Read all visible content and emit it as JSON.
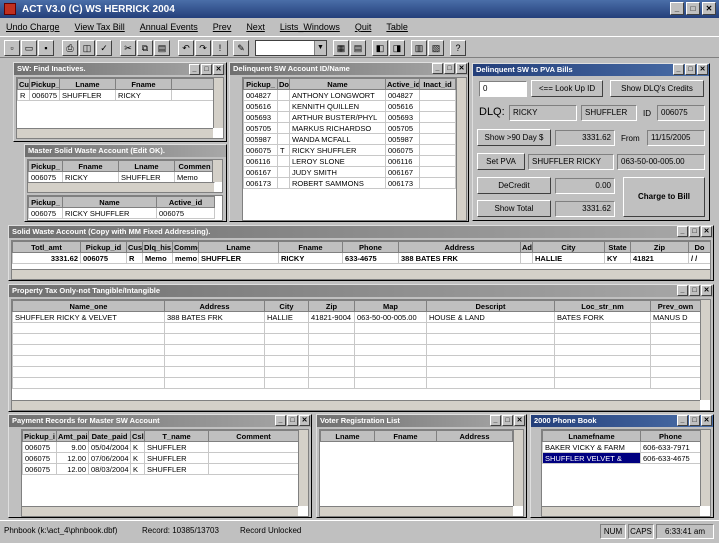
{
  "app": {
    "title": "ACT V3.0 (C) WS HERRICK 2004"
  },
  "menu": [
    "Undo Charge",
    "View Tax Bill",
    "Annual Events",
    "Prev",
    "Next",
    "Lists_Windows",
    "Quit",
    "Table"
  ],
  "sw_find": {
    "title": "SW: Find Inactives.",
    "headers": [
      "Cu",
      "Pickup_",
      "Lname",
      "Fname"
    ],
    "rows": [
      [
        "R",
        "006075",
        "SHUFFLER",
        "RICKY"
      ]
    ]
  },
  "master_sw": {
    "title": "Master Solid Waste Account (Edit OK).",
    "headers": [
      "Pickup_",
      "Fname",
      "Lname",
      "Commen"
    ],
    "rows": [
      [
        "006075",
        "RICKY",
        "SHUFFLER",
        "Memo"
      ]
    ],
    "headers2": [
      "Pickup_",
      "Name",
      "Active_id"
    ],
    "rows2": [
      [
        "006075",
        "RICKY SHUFFLER",
        "006075"
      ]
    ]
  },
  "delinquent_id": {
    "title": "Delinquent SW Account ID/Name",
    "headers": [
      "Pickup_",
      "Do",
      "Name",
      "Active_id",
      "Inact_id"
    ],
    "rows": [
      [
        "004827",
        "",
        "ANTHONY LONGWORT",
        "004827",
        ""
      ],
      [
        "005616",
        "",
        "KENNITH QUILLEN",
        "005616",
        ""
      ],
      [
        "005693",
        "",
        "ARTHUR BUSTER/PHYL",
        "005693",
        ""
      ],
      [
        "005705",
        "",
        "MARKUS RICHARDSO",
        "005705",
        ""
      ],
      [
        "005987",
        "",
        "WANDA MCFALL",
        "005987",
        ""
      ],
      [
        "006075",
        "T",
        "RICKY SHUFFLER",
        "006075",
        ""
      ],
      [
        "006116",
        "",
        "LEROY SLONE",
        "006116",
        ""
      ],
      [
        "006167",
        "",
        "JUDY SMITH",
        "006167",
        ""
      ],
      [
        "006173",
        "",
        "ROBERT SAMMONS",
        "006173",
        ""
      ]
    ]
  },
  "pva": {
    "title": "Delinquent SW to PVA Bills",
    "lookup_value": "0",
    "lookup_btn": "<== Look Up ID",
    "show_dlq_btn": "Show DLQ's Credits",
    "dlq_label": "DLQ:",
    "dlq_fname": "RICKY",
    "dlq_lname": "SHUFFLER",
    "id_label": "ID",
    "id_value": "006075",
    "show90_btn": "Show >90 Day $",
    "show90_value": "3331.62",
    "from_label": "From",
    "from_value": "11/15/2005",
    "setpva_btn": "Set PVA",
    "setpva_name": "SHUFFLER RICKY",
    "setpva_map": "063-50-00-005.00",
    "decredit_btn": "DeCredit",
    "decredit_value": "0.00",
    "showtotal_btn": "Show Total",
    "showtotal_value": "3331.62",
    "charge_btn": "Charge to Bill"
  },
  "sw_account": {
    "title": "Solid Waste  Account  (Copy with MM Fixed Addressing).",
    "headers": [
      "Totl_amt",
      "Pickup_id",
      "Cus",
      "Dlq_his",
      "Comme",
      "Lname",
      "Fname",
      "Phone",
      "Address",
      "Ad",
      "City",
      "State",
      "Zip",
      "Do"
    ],
    "rows": [
      [
        "3331.62",
        "006075",
        "R",
        "Memo",
        "memo",
        "SHUFFLER",
        "RICKY",
        "633-4675",
        "388 BATES FRK",
        "",
        "HALLIE",
        "KY",
        "41821",
        "/ /"
      ]
    ]
  },
  "property_tax": {
    "title": "Property Tax Only-not Tangible/Intangible",
    "headers": [
      "Name_one",
      "Address",
      "City",
      "Zip",
      "Map",
      "Descript",
      "Loc_str_nm",
      "Prev_own"
    ],
    "rows": [
      [
        "SHUFFLER RICKY & VELVET",
        "388 BATES FRK",
        "HALLIE",
        "41821-9004",
        "063-50-00-005.00",
        "HOUSE & LAND",
        "BATES FORK",
        "MANUS D"
      ]
    ]
  },
  "payments": {
    "title": "Payment Records for Master SW Account",
    "headers": [
      "Pickup_i",
      "Amt_paid",
      "Date_paid",
      "Csl",
      "T_name",
      "Comment"
    ],
    "rows": [
      [
        "006075",
        "9.00",
        "05/04/2004",
        "K",
        "SHUFFLER",
        ""
      ],
      [
        "006075",
        "12.00",
        "07/06/2004",
        "K",
        "SHUFFLER",
        ""
      ],
      [
        "006075",
        "12.00",
        "08/03/2004",
        "K",
        "SHUFFLER",
        ""
      ]
    ]
  },
  "voter": {
    "title": "Voter Registration List",
    "headers": [
      "Lname",
      "Fname",
      "Address"
    ]
  },
  "phonebook": {
    "title": "2000 Phone Book",
    "headers": [
      "Lnamefname",
      "Phone"
    ],
    "rows": [
      [
        "BAKER VICKY & FARM",
        "606-633-7971"
      ],
      [
        "SHUFFLER VELVET &",
        "606-633-4675"
      ]
    ]
  },
  "status": {
    "file": "Phnbook (k:\\act_4\\phnbook.dbf)",
    "record": "Record: 10385/13703",
    "lock": "Record Unlocked",
    "num": "NUM",
    "caps": "CAPS",
    "time": "6:33:41 am"
  }
}
